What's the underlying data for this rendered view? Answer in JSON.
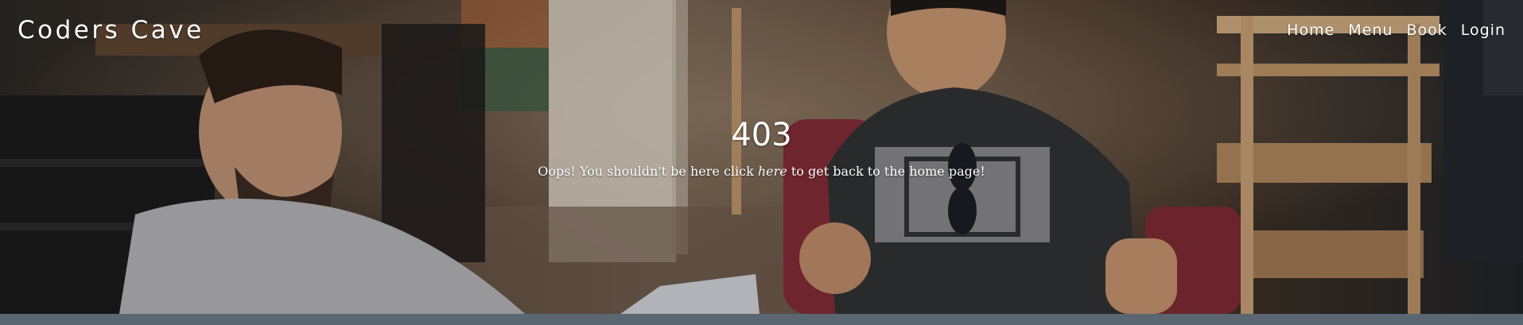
{
  "header": {
    "brand": "Coders Cave",
    "nav": [
      {
        "label": "Home"
      },
      {
        "label": "Menu"
      },
      {
        "label": "Book"
      },
      {
        "label": "Login"
      }
    ]
  },
  "error": {
    "code": "403",
    "message_before": "Oops! You shouldn't be here click ",
    "link_text": "here",
    "message_after": " to get back to the home page!"
  },
  "colors": {
    "footer_strip": "#5b6673",
    "text": "#ffffff"
  }
}
